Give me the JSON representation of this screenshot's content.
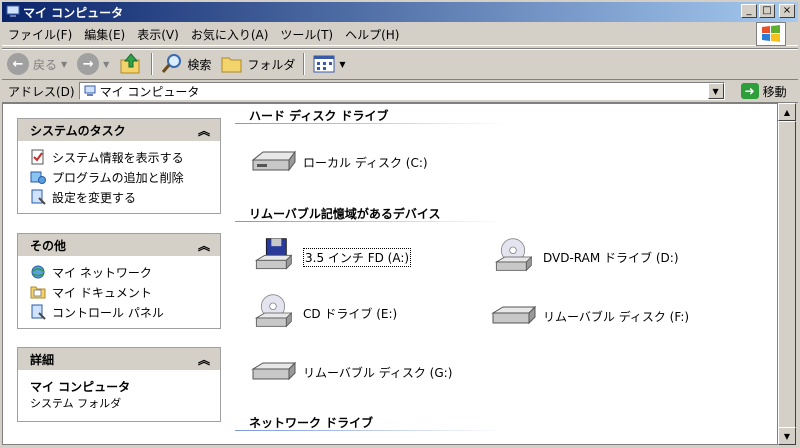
{
  "window": {
    "title": "マイ コンピュータ"
  },
  "menu": [
    "ファイル(F)",
    "編集(E)",
    "表示(V)",
    "お気に入り(A)",
    "ツール(T)",
    "ヘルプ(H)"
  ],
  "toolbar": {
    "back": "戻る",
    "search": "検索",
    "folders": "フォルダ"
  },
  "address": {
    "label": "アドレス(D)",
    "value": "マイ コンピュータ",
    "go": "移動"
  },
  "panels": {
    "system_tasks": {
      "title": "システムのタスク",
      "items": [
        "システム情報を表示する",
        "プログラムの追加と削除",
        "設定を変更する"
      ]
    },
    "other_places": {
      "title": "その他",
      "items": [
        "マイ ネットワーク",
        "マイ ドキュメント",
        "コントロール パネル"
      ]
    },
    "details": {
      "title": "詳細",
      "name": "マイ コンピュータ",
      "type": "システム フォルダ"
    }
  },
  "sections": {
    "hdd": "ハード ディスク ドライブ",
    "removable": "リムーバブル記憶域があるデバイス",
    "network": "ネットワーク ドライブ"
  },
  "drives": {
    "local_c": "ローカル ディスク (C:)",
    "fd_a": "3.5 インチ FD (A:)",
    "dvd_d": "DVD-RAM ドライブ (D:)",
    "cd_e": "CD ドライブ (E:)",
    "rem_f": "リムーバブル ディスク (F:)",
    "rem_g": "リムーバブル ディスク (G:)"
  },
  "colors": {
    "titlebar_start": "#0a246a",
    "titlebar_end": "#a6caf0",
    "panel_header": "#d4d0c8"
  }
}
